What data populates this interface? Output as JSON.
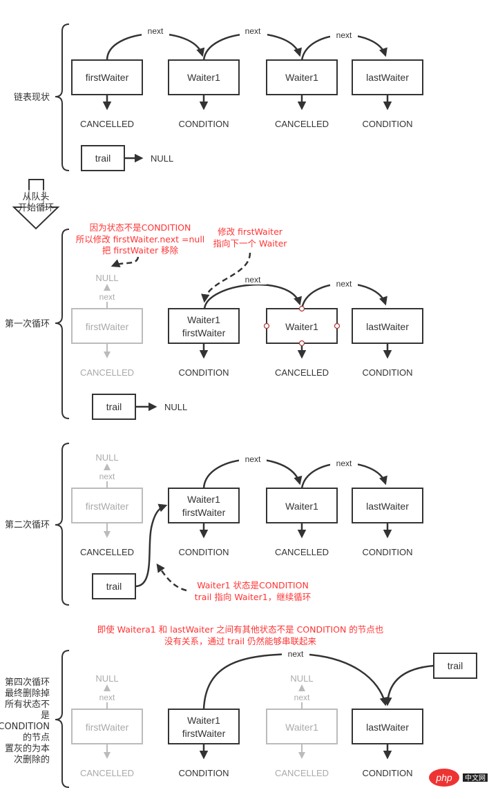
{
  "labels": {
    "next": "next",
    "null": "NULL",
    "trail": "trail",
    "cancelled": "CANCELLED",
    "condition": "CONDITION"
  },
  "nodes": {
    "firstWaiter": "firstWaiter",
    "waiter1": "Waiter1",
    "lastWaiter": "lastWaiter",
    "waiter1_line1": "Waiter1",
    "waiter1_line2": "firstWaiter"
  },
  "sections": {
    "current": "链表现状",
    "loop_start_1": "从队头",
    "loop_start_2": "开始循环",
    "first_loop": "第一次循环",
    "second_loop": "第二次循环",
    "fourth_loop": [
      "第四次循环",
      "最终删除掉",
      "所有状态不",
      "是",
      "CONDITION",
      "的节点",
      "置灰的为本",
      "次删除的"
    ]
  },
  "notes": {
    "first_loop_a": [
      "因为状态不是CONDITION",
      "所以修改 firstWaiter.next =null",
      "把 firstWaiter 移除"
    ],
    "first_loop_b": [
      "修改 firstWaiter",
      "指向下一个 Waiter"
    ],
    "second_loop": [
      "Waiter1 状态是CONDITION",
      "trail 指向 Waiter1，继续循环"
    ],
    "fourth_loop": [
      "即使 Waitera1 和 lastWaiter 之间有其他状态不是 CONDITION 的节点也",
      "没有关系，通过 trail 仍然能够串联起来"
    ]
  },
  "watermark": {
    "logo": "php",
    "text": "中文网"
  },
  "colors": {
    "stroke": "#333333",
    "gray": "#bbbbbb",
    "note": "#ff3333"
  }
}
